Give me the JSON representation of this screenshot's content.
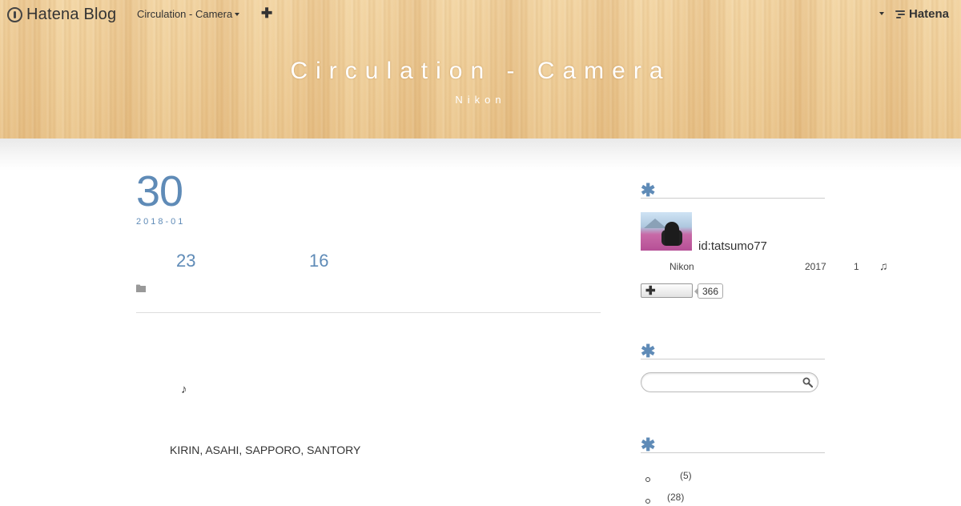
{
  "topbar": {
    "logo_text": "Hatena Blog",
    "blog_switch_label": "Circulation - Camera",
    "add_label": "✚",
    "hatena_label": "Hatena"
  },
  "header": {
    "title": "Circulation - Camera",
    "subtitle": "Nikon"
  },
  "article": {
    "date_day": "30",
    "date_year_month": "2018-01",
    "title_num_1": "23",
    "title_num_2": "16",
    "note_glyph": "♪",
    "body_text": "KIRIN, ASAHI, SAPPORO, SANTORY"
  },
  "sidebar": {
    "profile": {
      "user_id": "id:tatsumo77",
      "about_text": "Nikon",
      "about_year": "2017",
      "about_num": "1",
      "about_note": "♫",
      "follow_plus": "✚",
      "follower_count": "366"
    },
    "search": {
      "placeholder": ""
    },
    "categories": [
      {
        "count": "(5)"
      },
      {
        "count": "(28)"
      }
    ]
  },
  "colors": {
    "accent": "#5f8bb7",
    "header_wood": "#eecb95"
  }
}
